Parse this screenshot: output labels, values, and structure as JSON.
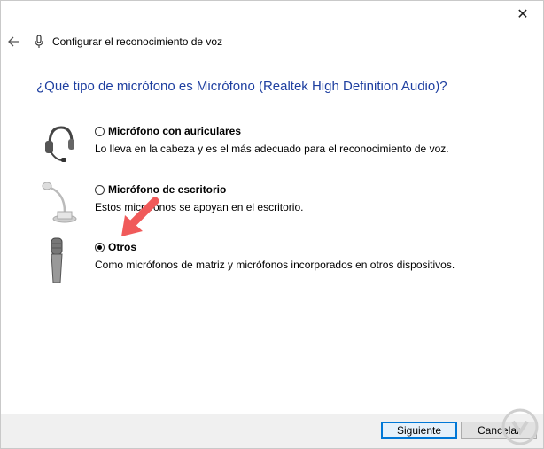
{
  "window": {
    "title": "Configurar el reconocimiento de voz",
    "close_glyph": "✕"
  },
  "heading": "¿Qué tipo de micrófono es Micrófono (Realtek High Definition Audio)?",
  "options": [
    {
      "label": "Micrófono con auriculares",
      "description": "Lo lleva en la cabeza y es el más adecuado para el reconocimiento de voz.",
      "selected": false,
      "icon": "headset-icon"
    },
    {
      "label": "Micrófono de escritorio",
      "description": "Estos micrófonos se apoyan en el escritorio.",
      "selected": false,
      "icon": "desktop-mic-icon"
    },
    {
      "label": "Otros",
      "description": "Como micrófonos de matriz y micrófonos incorporados en otros dispositivos.",
      "selected": true,
      "icon": "handheld-mic-icon"
    }
  ],
  "buttons": {
    "next": "Siguiente",
    "cancel": "Cancelar"
  },
  "colors": {
    "heading": "#1e3fa0",
    "arrow": "#f05a5a",
    "primary_border": "#0078d7"
  }
}
